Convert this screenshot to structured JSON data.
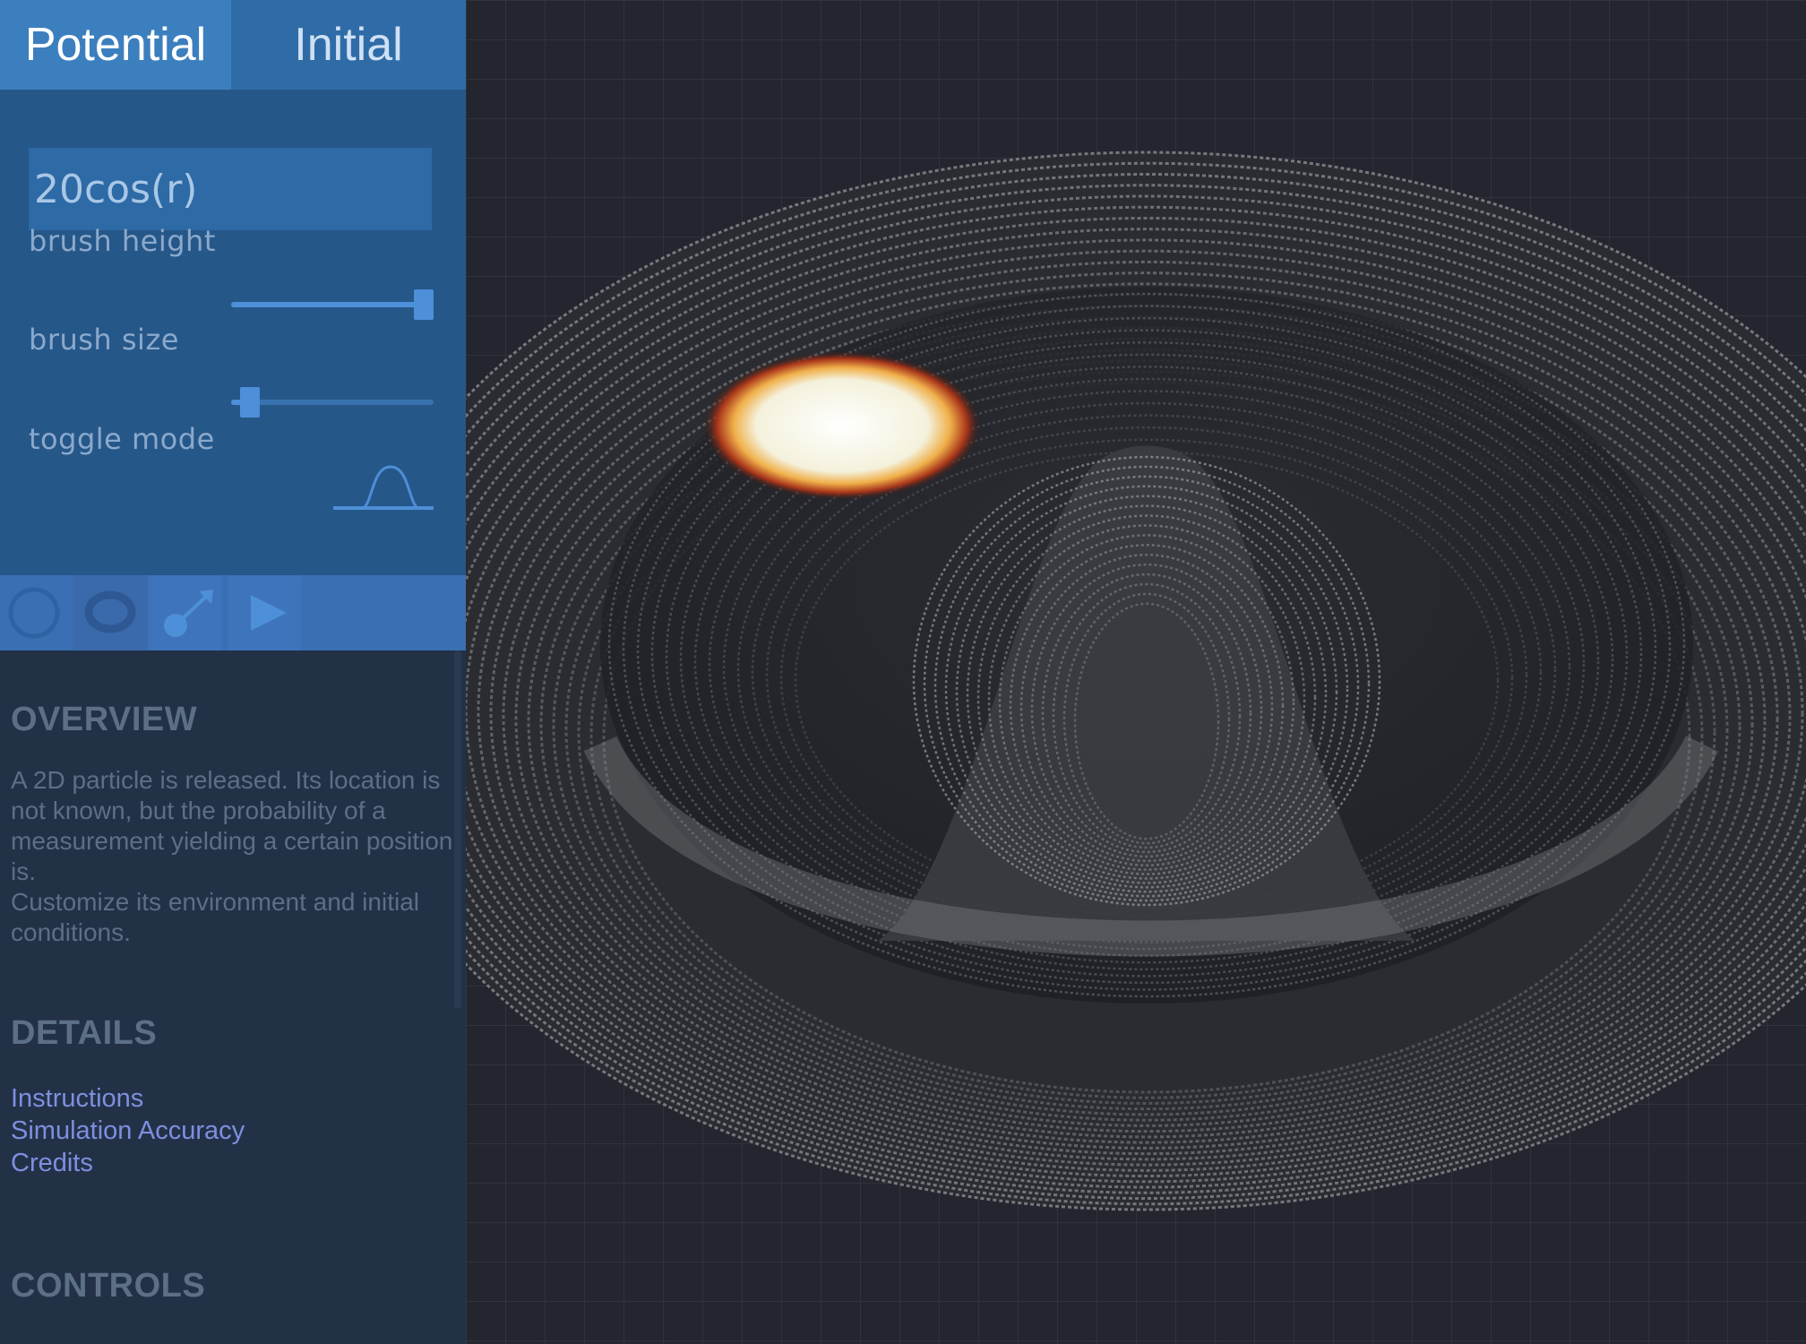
{
  "tabs": {
    "potential_label": "Potential",
    "initial_label": "Initial",
    "active": "Potential"
  },
  "formula": {
    "value": "20cos(r)"
  },
  "controls": {
    "brush_height": {
      "label": "brush height",
      "level": 1.0
    },
    "brush_size": {
      "label": "brush size",
      "level": 0.05
    },
    "toggle_mode": {
      "label": "toggle mode",
      "icon": "bell-curve-icon"
    }
  },
  "toolbar": {
    "icons": [
      "reset-circle-icon",
      "ring-icon",
      "launch-arrow-icon",
      "play-icon"
    ]
  },
  "overview": {
    "heading": "OVERVIEW",
    "line1": "A 2D particle is released.  Its location is not known, but the probability of a measurement yielding a certain position is.",
    "line2": "Customize its environment and initial conditions."
  },
  "details": {
    "heading": "DETAILS",
    "links": [
      "Instructions",
      "Simulation Accuracy",
      "Credits"
    ]
  },
  "controls_section": {
    "heading": "CONTROLS"
  },
  "colors": {
    "panel": "#223146",
    "controls_bg": "#265789",
    "accent": "#4d8fd8",
    "tab_active": "#3c7fbf",
    "link": "#7e8fe0",
    "viewport": "#23262e"
  }
}
